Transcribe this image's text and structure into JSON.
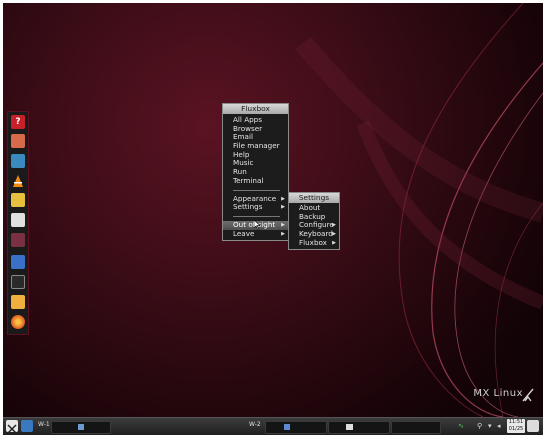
{
  "root_menu": {
    "title": "Fluxbox",
    "items": [
      {
        "label": "All Apps"
      },
      {
        "label": "Browser"
      },
      {
        "label": "Email"
      },
      {
        "label": "File manager"
      },
      {
        "label": "Help"
      },
      {
        "label": "Music"
      },
      {
        "label": "Run"
      },
      {
        "label": "Terminal"
      }
    ],
    "submenus": [
      {
        "label": "Appearance"
      },
      {
        "label": "Settings"
      }
    ],
    "extra": [
      {
        "label": "Out of sight",
        "highlighted": true
      },
      {
        "label": "Leave"
      }
    ]
  },
  "settings_menu": {
    "title": "Settings",
    "items": [
      {
        "label": "About",
        "has_submenu": false
      },
      {
        "label": "Backup",
        "has_submenu": false
      },
      {
        "label": "Configure",
        "has_submenu": true
      },
      {
        "label": "Keyboard",
        "has_submenu": true
      },
      {
        "label": "Fluxbox",
        "has_submenu": true
      }
    ]
  },
  "branding": {
    "text": "MX Linux"
  },
  "taskbar": {
    "workspace_1": "W-1",
    "workspace_2": "W-2",
    "clock_time": "11:51",
    "clock_date": "01/25"
  },
  "dock_icons": [
    "help-icon",
    "toolbox-icon",
    "image-viewer-icon",
    "vlc-icon",
    "document-icon",
    "text-editor-icon",
    "package-icon",
    "writer-icon",
    "terminal-icon",
    "folder-icon",
    "firefox-icon"
  ],
  "colors": {
    "desktop_bg": "#3a0c16",
    "accent": "#8b1a30",
    "menu_bg": "#1c1c1c",
    "highlight": "#5c5c5c"
  }
}
